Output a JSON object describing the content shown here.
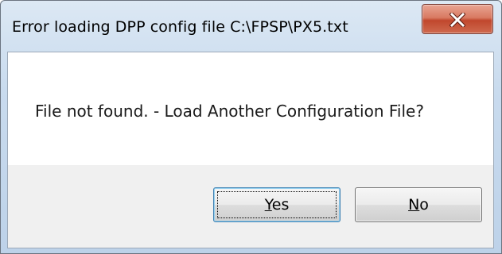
{
  "dialog": {
    "title": "Error loading DPP config file C:\\FPSP\\PX5.txt",
    "message": "File not found. - Load Another Configuration File?",
    "close_icon": "close-icon"
  },
  "buttons": {
    "yes": {
      "accel": "Y",
      "rest": "es"
    },
    "no": {
      "accel": "N",
      "rest": "o"
    }
  },
  "colors": {
    "close_button": "#c9503a",
    "focus_border": "#3c7fb1"
  }
}
